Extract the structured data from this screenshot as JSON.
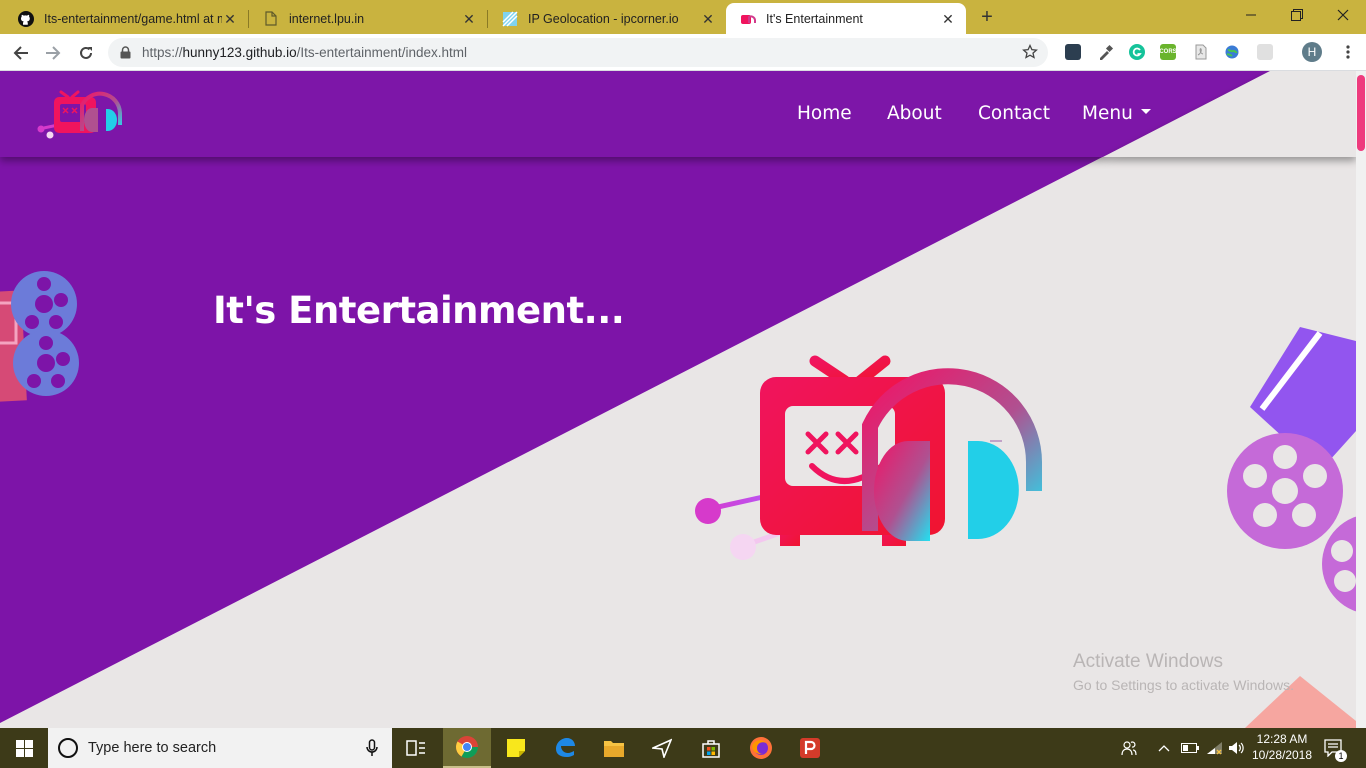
{
  "browser": {
    "tabs": [
      {
        "title": "Its-entertainment/game.html at m",
        "favicon": "github-icon"
      },
      {
        "title": "internet.lpu.in",
        "favicon": "document-icon"
      },
      {
        "title": "IP Geolocation - ipcorner.io",
        "favicon": "ipcorner-icon"
      },
      {
        "title": "It's Entertainment",
        "favicon": "site-logo-icon",
        "active": true
      }
    ],
    "url_prefix": "https://",
    "url_host": "hunny123.github.io",
    "url_path": "/Its-entertainment/index.html",
    "profile_initial": "H",
    "extension_cors_label": "CORS"
  },
  "page": {
    "nav": [
      "Home",
      "About",
      "Contact",
      "Menu"
    ],
    "hero_title": "It's Entertainment...",
    "colors": {
      "purple": "#7d14a8",
      "background": "#e9e6e6",
      "accent_pink": "#f0145e",
      "accent_cyan": "#22e0f0"
    }
  },
  "watermark": {
    "line1": "Activate Windows",
    "line2": "Go to Settings to activate Windows."
  },
  "taskbar": {
    "search_placeholder": "Type here to search",
    "time": "12:28 AM",
    "date": "10/28/2018",
    "notification_count": "1"
  }
}
